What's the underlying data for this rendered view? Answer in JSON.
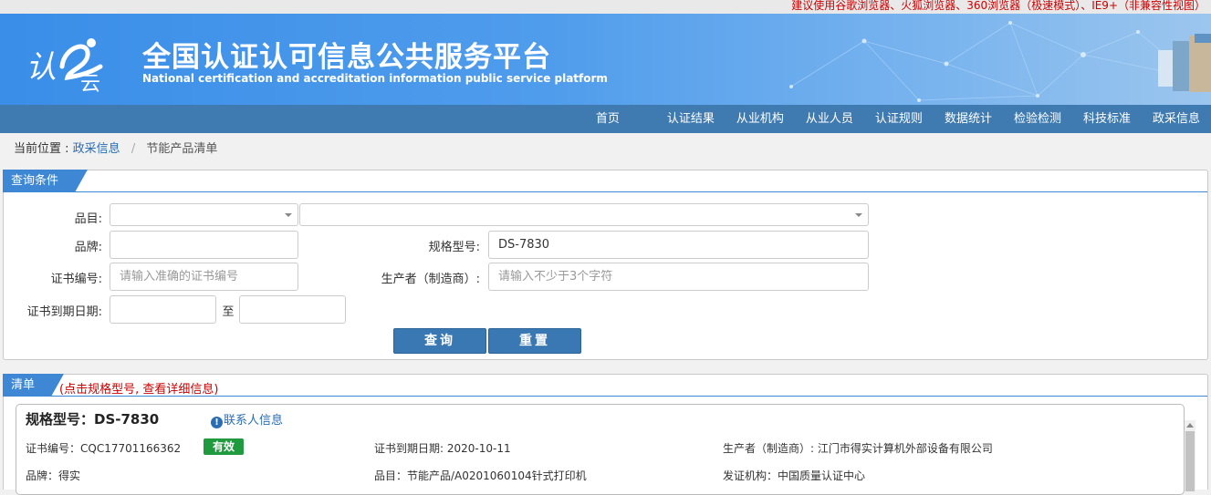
{
  "browser_note": "建议使用谷歌浏览器、火狐浏览器、360浏览器（极速模式）、IE9+（非兼容性视图）",
  "header": {
    "logo_text": "认云",
    "title_cn": "全国认证认可信息公共服务平台",
    "title_en": "National certification and accreditation information public service platform"
  },
  "nav": [
    "首页",
    "认证结果",
    "从业机构",
    "从业人员",
    "认证规则",
    "数据统计",
    "检验检测",
    "科技标准",
    "政采信息"
  ],
  "breadcrumb": {
    "prefix": "当前位置 :",
    "link": "政采信息",
    "separator": "/",
    "current": "节能产品清单"
  },
  "query": {
    "tab": "查询条件",
    "category_label": "品目:",
    "brand_label": "品牌:",
    "brand_value": "",
    "model_label": "规格型号:",
    "model_value": "DS-7830",
    "cert_no_label": "证书编号:",
    "cert_no_placeholder": "请输入准确的证书编号",
    "producer_label": "生产者（制造商）:",
    "producer_placeholder": "请输入不少于3个字符",
    "expiry_label": "证书到期日期:",
    "to_label": "至",
    "search_button": "查询",
    "reset_button": "重置"
  },
  "list": {
    "tab": "清单",
    "hint": "(点击规格型号, 查看详细信息)",
    "items": [
      {
        "model_title": "规格型号：DS-7830",
        "contact_link": "联系人信息",
        "cert_no": "证书编号：CQC17701166362",
        "status": "有效",
        "expiry": "证书到期日期: 2020-10-11",
        "producer": "生产者（制造商）: 江门市得实计算机外部设备有限公司",
        "brand": "品牌：得实",
        "category": "品目：节能产品/A0201060104针式打印机",
        "issuer": "发证机构：中国质量认证中心"
      }
    ]
  },
  "colors": {
    "nav_bg": "#3f7bb1",
    "tab_bg": "#3d87d4",
    "button_bg": "#3a78b4",
    "status_green": "#1f9a3f",
    "warning_red": "#cc0000"
  }
}
